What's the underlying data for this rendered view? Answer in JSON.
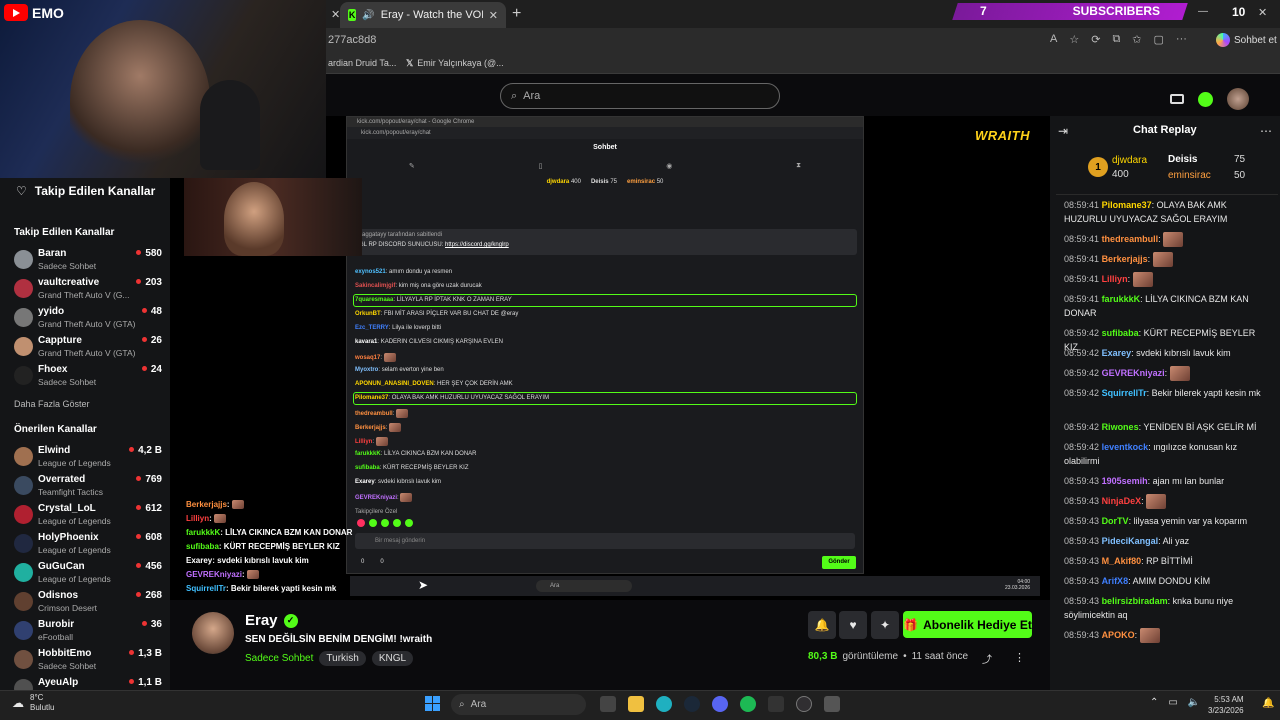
{
  "browser": {
    "tab_title": "Eray - Watch the VOD on Kick",
    "url_fragment": "277ac8d8",
    "bookmarks": [
      "ardian Druid Ta...",
      "Emir Yalçınkaya (@..."
    ],
    "subscribers_count": "7",
    "subscribers_label": "SUBSCRIBERS",
    "counter": "10",
    "sohbet_et": "Sohbet et"
  },
  "overlay": {
    "channel_tag": "EMO"
  },
  "header": {
    "search_placeholder": "Ara"
  },
  "sidebar": {
    "followed_title": "Takip Edilen Kanallar",
    "followed_subtitle": "Takip Edilen Kanallar",
    "followed": [
      {
        "name": "Baran",
        "game": "Sadece Sohbet",
        "viewers": "580",
        "color": "#8a8f95"
      },
      {
        "name": "vaultcreative",
        "game": "Grand Theft Auto V (G...",
        "viewers": "203",
        "color": "#b03040"
      },
      {
        "name": "yyido",
        "game": "Grand Theft Auto V (GTA)",
        "viewers": "48",
        "color": "#777"
      },
      {
        "name": "Cappture",
        "game": "Grand Theft Auto V (GTA)",
        "viewers": "26",
        "color": "#c09070"
      },
      {
        "name": "Fhoex",
        "game": "Sadece Sohbet",
        "viewers": "24",
        "color": "#222"
      }
    ],
    "show_more": "Daha Fazla Göster",
    "recommended_title": "Önerilen Kanallar",
    "recommended": [
      {
        "name": "Elwind",
        "game": "League of Legends",
        "viewers": "4,2 B",
        "color": "#a07050"
      },
      {
        "name": "Overrated",
        "game": "Teamfight Tactics",
        "viewers": "769",
        "color": "#3a4a60"
      },
      {
        "name": "Crystal_LoL",
        "game": "League of Legends",
        "viewers": "612",
        "color": "#b02030"
      },
      {
        "name": "HolyPhoenix",
        "game": "League of Legends",
        "viewers": "608",
        "color": "#202840"
      },
      {
        "name": "GuGuCan",
        "game": "League of Legends",
        "viewers": "456",
        "color": "#20b0a0"
      },
      {
        "name": "Odisnos",
        "game": "Crimson Desert",
        "viewers": "268",
        "color": "#604030"
      },
      {
        "name": "Burobir",
        "game": "eFootball",
        "viewers": "36",
        "color": "#304070"
      },
      {
        "name": "HobbitEmo",
        "game": "Sadece Sohbet",
        "viewers": "1,3 B",
        "color": "#705040"
      },
      {
        "name": "AyeuAlp",
        "game": "",
        "viewers": "1,1 B",
        "color": "#505050"
      }
    ]
  },
  "popout": {
    "window_title": "kick.com/popout/eray/chat - Google Chrome",
    "url": "kick.com/popout/eray/chat",
    "header": "Sohbet",
    "top1": {
      "name": "djwdara",
      "amount": "400"
    },
    "top2": {
      "name": "Deisis",
      "amount": "75"
    },
    "top3": {
      "name": "eminsirac",
      "amount": "50"
    },
    "pinned_by": "caggatayy tarafından sabitlendi",
    "pinned_text": "GL RP DISCORD SUNUCUSU:",
    "pinned_link": "https://discord.gg/knglrp",
    "messages": [
      {
        "user": "exynos521",
        "text": "amım dondu ya resmen",
        "color": "#4fc0ff"
      },
      {
        "user": "Sakincalimjgif",
        "text": "kim miş ona göre uzak durucak",
        "color": "#e05050"
      },
      {
        "user": "7quaresmaaa",
        "text": "LİLYAYLA RP İPTAK KNK O ZAMAN ERAY",
        "color": "#53fc18"
      },
      {
        "user": "OrkunBT",
        "text": "FBI MİT ARASI PİÇLER VAR BU CHAT DE @eray",
        "color": "#ffd700"
      },
      {
        "user": "Ezc_TERRY",
        "text": "Lilya ile loverp bitti",
        "color": "#4080ff"
      },
      {
        "user": "kavara1",
        "text": "KADERIN CILVESI CIKMIŞ KARŞINA EVLEN",
        "color": "#ffffff"
      },
      {
        "user": "wosaq17",
        "text": "",
        "color": "#ff8040"
      },
      {
        "user": "Myoxtro",
        "text": "selam everton yine ben",
        "color": "#80c0ff"
      },
      {
        "user": "APONUN_ANASINI_DOVEN",
        "text": "HER ŞEY ÇOK DERİN AMK",
        "color": "#ffd700"
      },
      {
        "user": "Pilomane37",
        "text": "OLAYA BAK AMK HUZURLU UYUYACAZ SAĞOL ERAYIM",
        "color": "#ffd700"
      },
      {
        "user": "thedreambull",
        "text": "",
        "color": "#ff9040"
      },
      {
        "user": "Berkerjajjs",
        "text": "",
        "color": "#ff9040"
      },
      {
        "user": "Lilliyn",
        "text": "",
        "color": "#ff4040"
      },
      {
        "user": "farukkkK",
        "text": "LİLYA CIKINCA BZM KAN DONAR",
        "color": "#53fc18"
      },
      {
        "user": "sufibaba",
        "text": "KÜRT RECEPMİŞ BEYLER KIZ",
        "color": "#53fc18"
      },
      {
        "user": "Exarey",
        "text": "svdeki kıbrıslı lavuk kim",
        "color": "#ffffff"
      },
      {
        "user": "GEVREKniyazi",
        "text": "",
        "color": "#c070ff"
      }
    ],
    "followers_only": "Takipçilere Özel",
    "input_placeholder": "Bir mesaj gönderin",
    "send": "Gönder",
    "count_a": "0",
    "count_b": "0",
    "taskbar_search": "Ara",
    "taskbar_time": "04:00",
    "taskbar_date": "23.03.2026"
  },
  "video_overlay_chat": [
    {
      "user": "Berkerjajjs",
      "text": "",
      "color": "#ff9040"
    },
    {
      "user": "Lilliyn",
      "text": "",
      "color": "#ff4040"
    },
    {
      "user": "farukkkK",
      "text": "LİLYA CIKINCA BZM KAN DONAR",
      "color": "#53fc18"
    },
    {
      "user": "sufibaba",
      "text": "KÜRT RECEPMİŞ BEYLER KIZ",
      "color": "#53fc18"
    },
    {
      "user": "Exarey",
      "text": "svdeki kıbrıslı lavuk kim",
      "color": "#ffffff"
    },
    {
      "user": "GEVREKniyazi",
      "text": "",
      "color": "#c070ff"
    },
    {
      "user": "SquirrellTr",
      "text": "Bekir bilerek yapti kesin mk",
      "color": "#40c0ff"
    }
  ],
  "wraith": "WRAITH",
  "stream": {
    "streamer": "Eray",
    "title": "SEN DEĞİLSİN BENİM DENGİM! !wraith",
    "category": "Sadece Sohbet",
    "tags": [
      "Turkish",
      "KNGL"
    ],
    "views": "80,3 B",
    "views_label": "görüntüleme",
    "time_ago": "11 saat önce",
    "gift_button": "Abonelik Hediye Et"
  },
  "chat_replay": {
    "title": "Chat Replay",
    "top1": {
      "name": "djwdara",
      "amount": "400"
    },
    "top2": {
      "name": "Deisis",
      "amount": "75"
    },
    "top3": {
      "name": "eminsirac",
      "amount": "50"
    },
    "messages": [
      {
        "time": "08:59:41",
        "user": "Pilomane37",
        "text": "OLAYA BAK AMK HUZURLU UYUYACAZ SAĞOL ERAYIM",
        "color": "#ffd700",
        "emote": false
      },
      {
        "time": "08:59:41",
        "user": "thedreambull",
        "text": "",
        "color": "#ff9040",
        "emote": true
      },
      {
        "time": "08:59:41",
        "user": "Berkerjajjs",
        "text": "",
        "color": "#ff9040",
        "emote": true
      },
      {
        "time": "08:59:41",
        "user": "Lilliyn",
        "text": "",
        "color": "#ff4040",
        "emote": true
      },
      {
        "time": "08:59:41",
        "user": "farukkkK",
        "text": "LİLYA CIKINCA BZM KAN DONAR",
        "color": "#53fc18",
        "emote": false
      },
      {
        "time": "08:59:42",
        "user": "sufibaba",
        "text": "KÜRT RECEPMİŞ BEYLER KIZ",
        "color": "#53fc18",
        "emote": false
      },
      {
        "time": "08:59:42",
        "user": "Exarey",
        "text": "svdeki kıbrıslı lavuk kim",
        "color": "#80c0ff",
        "emote": false
      },
      {
        "time": "08:59:42",
        "user": "GEVREKniyazi",
        "text": "",
        "color": "#c070ff",
        "emote": true
      },
      {
        "time": "08:59:42",
        "user": "SquirrellTr",
        "text": "Bekir bilerek yapti kesin mk",
        "color": "#40c0ff",
        "emote": false
      },
      {
        "time": "08:59:42",
        "user": "Riwones",
        "text": "YENİDEN Bİ AŞK GELİR Mİ",
        "color": "#53fc18",
        "emote": false
      },
      {
        "time": "08:59:42",
        "user": "leventkock",
        "text": "ıngılızce konusan kız olabilirmi",
        "color": "#4080ff",
        "emote": false
      },
      {
        "time": "08:59:43",
        "user": "1905semih",
        "text": "ajan mı lan bunlar",
        "color": "#c070ff",
        "emote": false
      },
      {
        "time": "08:59:43",
        "user": "NinjaDeX",
        "text": "",
        "color": "#ff4040",
        "emote": true
      },
      {
        "time": "08:59:43",
        "user": "DorTV",
        "text": "lilyasa yemin var ya koparım",
        "color": "#53fc18",
        "emote": false
      },
      {
        "time": "08:59:43",
        "user": "PideciKangal",
        "text": "Ali yaz",
        "color": "#80c0ff",
        "emote": false
      },
      {
        "time": "08:59:43",
        "user": "M_Akif80",
        "text": "RP BİTTİMİ",
        "color": "#ff9040",
        "emote": false
      },
      {
        "time": "08:59:43",
        "user": "ArifX8",
        "text": "AMIM DONDU KİM",
        "color": "#4080ff",
        "emote": false
      },
      {
        "time": "08:59:43",
        "user": "belirsizbiradam",
        "text": "knka bunu niye söylimicektin aq",
        "color": "#53fc18",
        "emote": false
      },
      {
        "time": "08:59:43",
        "user": "APOKO",
        "text": "",
        "color": "#ff9040",
        "emote": true
      }
    ]
  },
  "taskbar": {
    "weather_temp": "8°C",
    "weather_desc": "Bulutlu",
    "search": "Ara",
    "time": "5:53 AM",
    "date": "3/23/2026"
  }
}
